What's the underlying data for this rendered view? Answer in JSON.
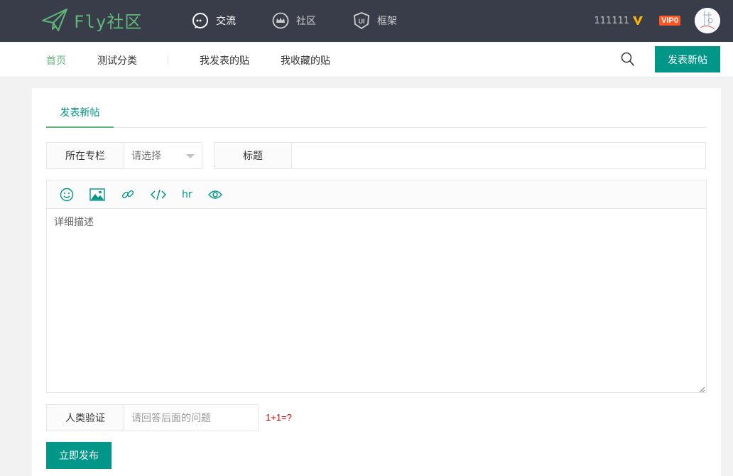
{
  "header": {
    "logo_text": "Fly社区",
    "nav": [
      {
        "label": "交流",
        "icon": "chat-icon"
      },
      {
        "label": "社区",
        "icon": "crown-icon"
      },
      {
        "label": "框架",
        "icon": "ui-shield-icon"
      }
    ],
    "user": {
      "name": "111111",
      "vip": "VIP0"
    }
  },
  "subnav": {
    "items": [
      "首页",
      "测试分类",
      "我发表的贴",
      "我收藏的贴"
    ],
    "post_button": "发表新帖"
  },
  "form": {
    "tab": "发表新帖",
    "column_label": "所在专栏",
    "column_select": "请选择",
    "title_label": "标题",
    "title_value": "",
    "toolbar": [
      "smile-icon",
      "image-icon",
      "link-icon",
      "code-icon",
      "hr",
      "eye-icon"
    ],
    "toolbar_hr_label": "hr",
    "content_placeholder": "详细描述",
    "captcha_label": "人类验证",
    "captcha_placeholder": "请回答后面的问题",
    "captcha_question": "1+1=?",
    "submit": "立即发布"
  },
  "colors": {
    "header_bg": "#393d49",
    "accent_green": "#5fb878",
    "primary": "#009688",
    "vip": "#ff5722",
    "v_badge": "#ffb800"
  }
}
